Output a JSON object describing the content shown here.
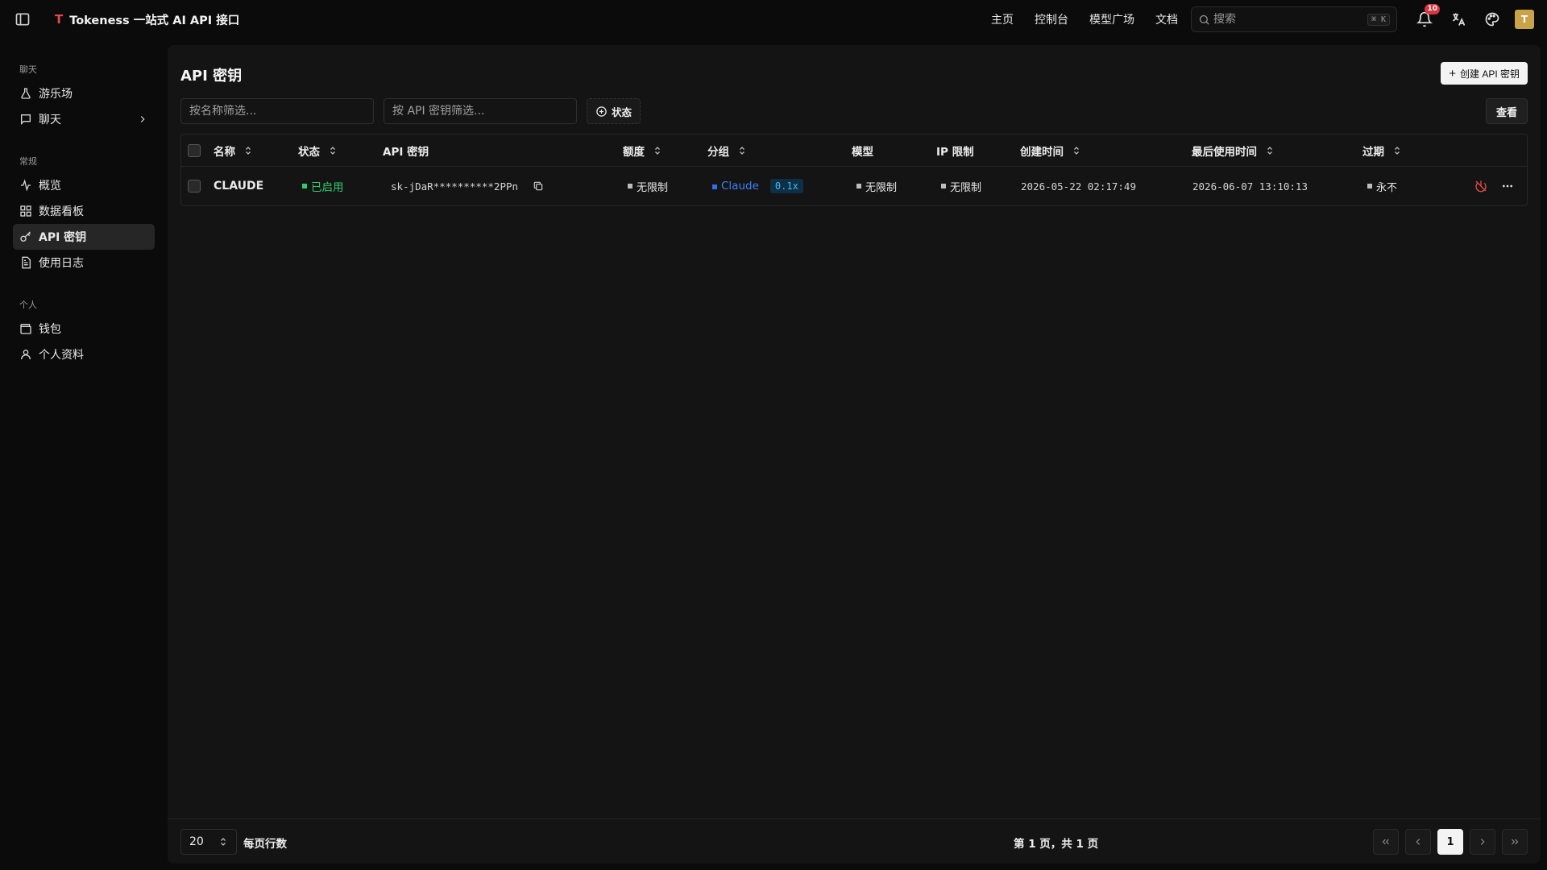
{
  "app": {
    "logo": "T",
    "title": "Tokeness 一站式 AI API 接口"
  },
  "topnav": {
    "home": "主页",
    "console": "控制台",
    "models": "模型广场",
    "docs": "文档"
  },
  "search": {
    "placeholder": "搜索",
    "shortcut": "⌘ K"
  },
  "notifications": {
    "count": "10"
  },
  "user": {
    "avatar_initial": "T"
  },
  "sidebar": {
    "groups": [
      {
        "label": "聊天",
        "items": [
          {
            "label": "游乐场",
            "icon": "flask-icon"
          },
          {
            "label": "聊天",
            "icon": "message-icon"
          }
        ]
      },
      {
        "label": "常规",
        "items": [
          {
            "label": "概览",
            "icon": "activity-icon"
          },
          {
            "label": "数据看板",
            "icon": "dashboard-icon"
          },
          {
            "label": "API 密钥",
            "icon": "key-icon",
            "active": true
          },
          {
            "label": "使用日志",
            "icon": "file-text-icon"
          }
        ]
      },
      {
        "label": "个人",
        "items": [
          {
            "label": "钱包",
            "icon": "wallet-icon"
          },
          {
            "label": "个人资料",
            "icon": "user-icon"
          }
        ]
      }
    ]
  },
  "page": {
    "title": "API 密钥",
    "create_label": "创建 API 密钥",
    "filter_name_placeholder": "按名称筛选...",
    "filter_key_placeholder": "按 API 密钥筛选...",
    "status_filter_label": "状态",
    "view_label": "查看"
  },
  "table": {
    "columns": {
      "name": "名称",
      "status": "状态",
      "key": "API 密钥",
      "quota": "额度",
      "group": "分组",
      "model": "模型",
      "ip": "IP 限制",
      "created": "创建时间",
      "last_used": "最后使用时间",
      "expiry": "过期"
    },
    "rows": [
      {
        "name": "CLAUDE",
        "status": "已启用",
        "key": "sk-jDaR**********2PPn",
        "quota": "无限制",
        "group": "Claude",
        "ratio": "0.1x",
        "model": "无限制",
        "ip": "无限制",
        "created": "2026-05-22 02:17:49",
        "last_used": "2026-06-07 13:10:13",
        "expiry": "永不"
      }
    ]
  },
  "footer": {
    "rows_per_page_value": "20",
    "rows_per_page_label": "每页行数",
    "page_info": "第 1 页，共 1 页",
    "current_page": "1"
  },
  "colors": {
    "accent_green": "#2ecc71",
    "accent_blue": "#3b82f6",
    "danger": "#e5484d",
    "brand": "#e5484d"
  }
}
